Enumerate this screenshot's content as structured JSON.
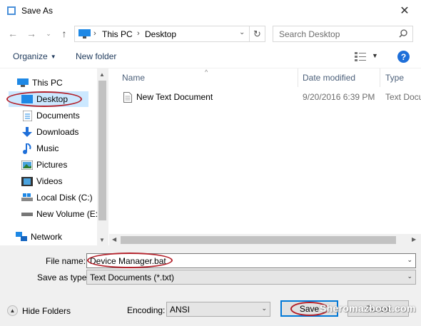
{
  "window": {
    "title": "Save As"
  },
  "nav": {
    "breadcrumb": [
      "This PC",
      "Desktop"
    ],
    "search_placeholder": "Search Desktop"
  },
  "toolbar": {
    "organize": "Organize",
    "new_folder": "New folder",
    "help": "?"
  },
  "sidebar": {
    "items": [
      {
        "label": "This PC",
        "icon": "pc-icon"
      },
      {
        "label": "Desktop",
        "icon": "desktop-icon",
        "selected": true
      },
      {
        "label": "Documents",
        "icon": "documents-icon"
      },
      {
        "label": "Downloads",
        "icon": "download-icon"
      },
      {
        "label": "Music",
        "icon": "music-icon"
      },
      {
        "label": "Pictures",
        "icon": "pictures-icon"
      },
      {
        "label": "Videos",
        "icon": "videos-icon"
      },
      {
        "label": "Local Disk (C:)",
        "icon": "drive-icon"
      },
      {
        "label": "New Volume (E:)",
        "icon": "drive-icon"
      },
      {
        "label": "Network",
        "icon": "network-icon"
      }
    ]
  },
  "files": {
    "columns": [
      "Name",
      "Date modified",
      "Type"
    ],
    "rows": [
      {
        "name": "New Text Document",
        "date": "9/20/2016 6:39 PM",
        "type": "Text Docu"
      }
    ]
  },
  "form": {
    "file_name_label": "File name:",
    "file_name_value": "Device Manager.bat",
    "save_type_label": "Save as type:",
    "save_type_value": "Text Documents (*.txt)",
    "encoding_label": "Encoding:",
    "encoding_value": "ANSI"
  },
  "footer": {
    "hide_folders": "Hide Folders",
    "save": "Save",
    "cancel": "Cancel"
  },
  "watermark": "Sheromazboot.com",
  "colors": {
    "selection": "#cce8ff",
    "accent": "#0078d7",
    "annotation": "#b3202a"
  }
}
